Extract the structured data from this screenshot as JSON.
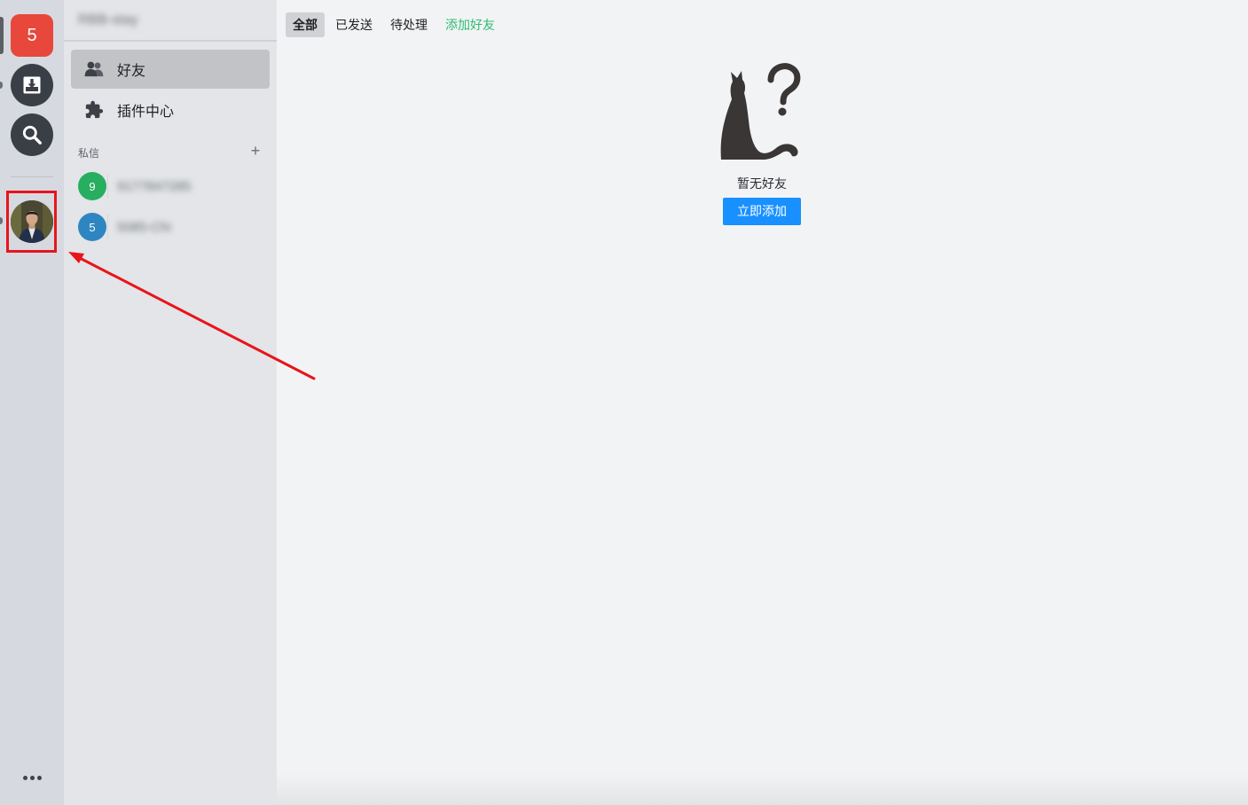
{
  "rail": {
    "home_badge": "5",
    "items": [
      {
        "name": "download-icon"
      },
      {
        "name": "search-icon"
      }
    ],
    "more_icon": "ellipsis-icon"
  },
  "sidebar": {
    "header_title": "RBB-stay",
    "nav": [
      {
        "label": "好友",
        "icon": "friends-icon",
        "active": true
      },
      {
        "label": "插件中心",
        "icon": "puzzle-icon",
        "active": false
      }
    ],
    "dm_section_title": "私信",
    "dm_add": "+",
    "dms": [
      {
        "avatar_text": "9",
        "name": "9177847285",
        "color": "#27ae60"
      },
      {
        "avatar_text": "5",
        "name": "5085-Chi",
        "color": "#2e86c1"
      }
    ]
  },
  "main": {
    "tabs": [
      {
        "label": "全部",
        "active": true
      },
      {
        "label": "已发送",
        "active": false
      },
      {
        "label": "待处理",
        "active": false
      },
      {
        "label": "添加好友",
        "active": false
      }
    ],
    "empty_label": "暂无好友",
    "empty_button": "立即添加"
  },
  "colors": {
    "accent_green": "#2dbd6e",
    "button_blue": "#1890ff",
    "home_red": "#e8473b",
    "annotation_red": "#e8141b"
  }
}
